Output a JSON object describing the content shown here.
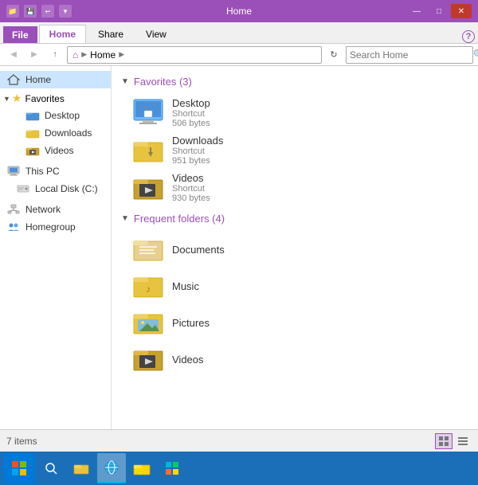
{
  "titleBar": {
    "title": "Home",
    "icons": [
      "📁",
      "💾",
      "📋"
    ],
    "minimize": "—",
    "maximize": "□",
    "close": "✕"
  },
  "ribbon": {
    "tabs": [
      "File",
      "Home",
      "Share",
      "View"
    ],
    "activeTab": "Home",
    "help": "?"
  },
  "addressBar": {
    "back": "←",
    "forward": "→",
    "up": "↑",
    "homeIcon": "⌂",
    "path": "Home",
    "chevron": "▶",
    "refresh": "↻",
    "searchPlaceholder": "Search Home",
    "searchIcon": "🔍"
  },
  "sidebar": {
    "homeLabel": "Home",
    "groups": [
      {
        "label": "Favorites",
        "items": [
          "Desktop",
          "Downloads",
          "Videos"
        ]
      }
    ],
    "items": [
      "This PC",
      "Local Disk (C:)",
      "Network",
      "Homegroup"
    ]
  },
  "content": {
    "favorites": {
      "header": "Favorites (3)",
      "items": [
        {
          "name": "Desktop",
          "type": "Shortcut",
          "size": "506 bytes"
        },
        {
          "name": "Downloads",
          "type": "Shortcut",
          "size": "951 bytes"
        },
        {
          "name": "Videos",
          "type": "Shortcut",
          "size": "930 bytes"
        }
      ]
    },
    "frequentFolders": {
      "header": "Frequent folders (4)",
      "items": [
        {
          "name": "Documents"
        },
        {
          "name": "Music"
        },
        {
          "name": "Pictures"
        },
        {
          "name": "Videos"
        }
      ]
    }
  },
  "statusBar": {
    "itemCount": "7 items",
    "viewLarge": "▦",
    "viewList": "≡"
  },
  "taskbar": {
    "startIcon": "⊞",
    "searchIcon": "🔍",
    "fileExplorerIcon": "📁",
    "ieIcon": "🌐",
    "folderIcon": "📂",
    "storeIcon": "🛍"
  }
}
